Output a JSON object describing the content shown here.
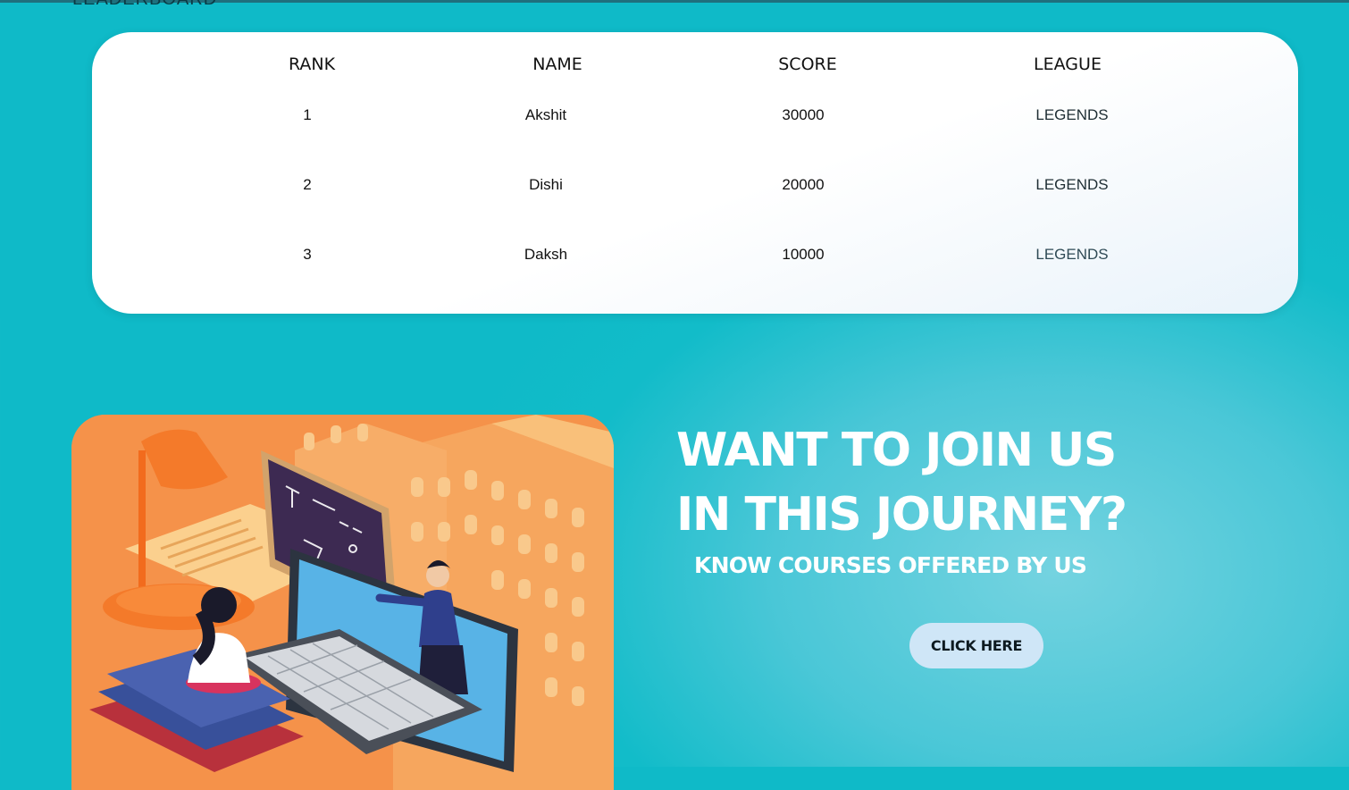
{
  "section": {
    "heading": "LEADERBOARD"
  },
  "leaderboard": {
    "columns": [
      "RANK",
      "NAME",
      "SCORE",
      "LEAGUE"
    ],
    "rows": [
      {
        "rank": "1",
        "name": "Akshit",
        "score": "30000",
        "league": "LEGENDS"
      },
      {
        "rank": "2",
        "name": "Dishi",
        "score": "20000",
        "league": "LEGENDS"
      },
      {
        "rank": "3",
        "name": "Daksh",
        "score": "10000",
        "league": "LEGENDS"
      }
    ]
  },
  "cta": {
    "title_line1": "WANT TO JOIN US",
    "title_line2": "IN THIS JOURNEY?",
    "subtitle": "KNOW COURSES OFFERED BY US",
    "button_label": "CLICK HERE"
  },
  "colors": {
    "page_background": "#0fbac8",
    "board_background": "#ffffff",
    "button_background": "#cfe6f7",
    "cta_text": "#ffffff",
    "illustration_background": "#f5924a"
  },
  "illustration": {
    "description_icon": "online-learning-illustration"
  }
}
